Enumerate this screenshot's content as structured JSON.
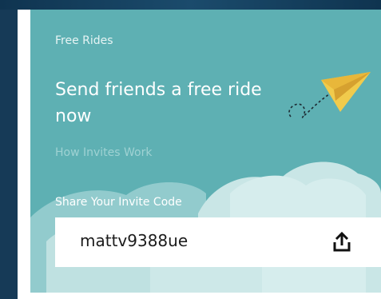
{
  "promo": {
    "eyebrow": "Free Rides",
    "headline": "Send friends a free ride now",
    "how_link": "How Invites Work",
    "share_label": "Share Your Invite Code",
    "invite_code": "mattv9388ue"
  },
  "icons": {
    "plane": "paper-plane-icon",
    "share": "share-icon"
  },
  "colors": {
    "card_bg": "#5eb0b3",
    "cloud_light": "#c9e6e6",
    "cloud_mid": "#a8d7d8",
    "plane_yellow": "#f1cb4c",
    "text_primary": "#ffffff",
    "link_color": "#9fd2d3",
    "code_box": "#ffffff",
    "code_text": "#1b1b1b"
  }
}
